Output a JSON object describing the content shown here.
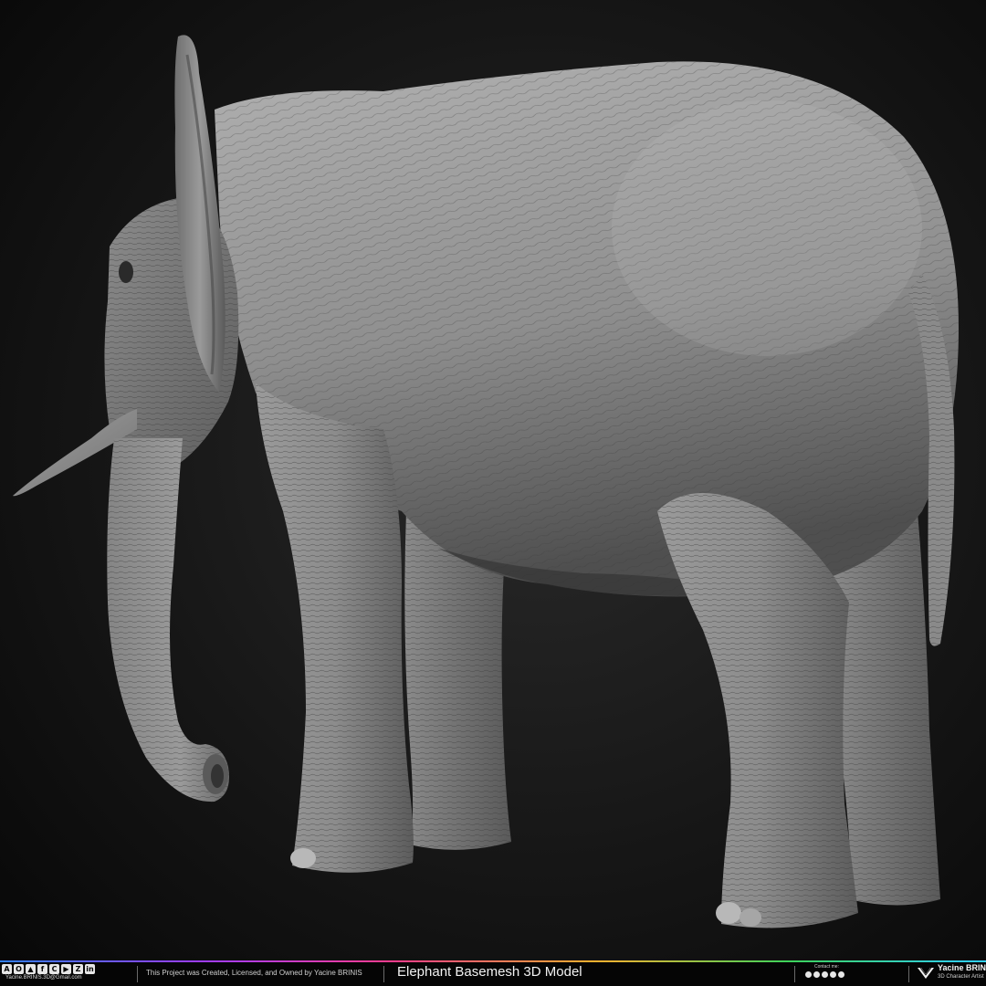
{
  "render": {
    "subject": "elephant",
    "view": "rear three-quarter",
    "colors": {
      "background": "#161616",
      "clay_light": "#a9a9a9",
      "clay_mid": "#7d7d7d",
      "clay_dark": "#4a4a4a"
    }
  },
  "footer": {
    "social_icons": [
      "a-icon",
      "o-icon",
      "artstation-icon",
      "f-icon",
      "c-icon",
      "tube-icon",
      "z-icon",
      "linkedin-icon"
    ],
    "email": "Yacine.BRINIS.3D@Gmail.com",
    "ownership": "This Project was Created, Licensed, and Owned by Yacine BRINIS",
    "title": "Elephant Basemesh 3D Model",
    "contact_label": "Contact me:",
    "contact_icons": [
      "facebook-icon",
      "instagram-icon",
      "youtube-icon",
      "artstation-icon",
      "3d-icon"
    ],
    "brand_name": "Yacine BRINIS",
    "brand_role": "3D Character Artist"
  }
}
